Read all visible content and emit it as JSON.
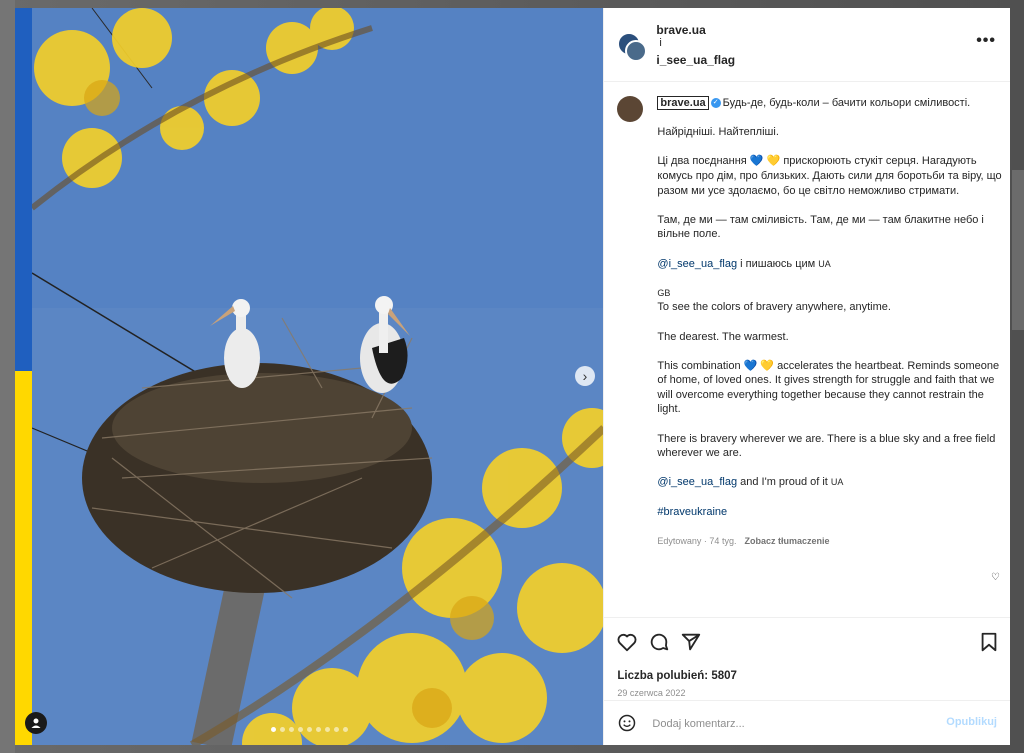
{
  "header": {
    "account1": "brave.ua",
    "joiner": "i",
    "account2": "i_see_ua_flag",
    "more_icon": "more-horizontal-icon"
  },
  "caption": {
    "username": "brave.ua",
    "line1": "Будь-де, будь-коли – бачити кольори сміливості.",
    "p1": "Найрідніші. Найтепліші.",
    "p2a": "Ці два поєднання",
    "p2b": "прискорюють стукіт серця. Нагадують комусь про дім, про близьких. Дають сили для боротьби та віру, що разом ми усе здолаємо, бо це світло неможливо стримати.",
    "p3": "Там, де ми — там сміливість. Там, де ми — там блакитне небо і вільне поле.",
    "mention1": "@i_see_ua_flag",
    "p4": "і пишаюсь цим",
    "tag_ua": "UA",
    "tag_gb": "GB",
    "en1": "To see the colors of bravery anywhere, anytime.",
    "en2": "The dearest. The warmest.",
    "en3a": "This combination",
    "en3b": "accelerates the heartbeat. Reminds someone of home, of loved ones. It gives strength for struggle and faith that we will overcome everything together because they cannot restrain the light.",
    "en4": "There is bravery wherever we are. There is a blue sky and a free field wherever we are.",
    "mention2": "@i_see_ua_flag",
    "en5": "and I'm proud of it",
    "hashtag": "#braveukraine",
    "edited": "Edytowany · 74 tyg.",
    "translate": "Zobacz tłumaczenie",
    "hearts": "💙 💛"
  },
  "footer": {
    "likes": "Liczba polubień: 5807",
    "date": "29 czerwca 2022",
    "comment_placeholder": "Dodaj komentarz...",
    "post_label": "Opublikuj"
  },
  "carousel": {
    "count": 9,
    "active": 0
  },
  "colors": {
    "flag_blue": "#1f5fbf",
    "flag_yellow": "#ffd800",
    "sky": "#5b86c4",
    "link": "#00376b"
  }
}
